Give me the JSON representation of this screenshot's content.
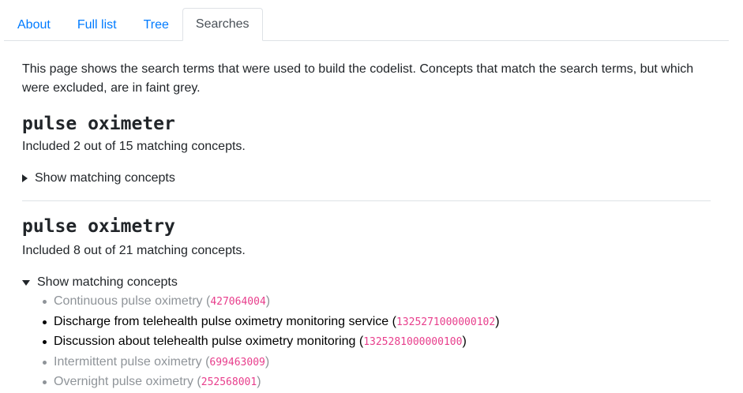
{
  "tabs": [
    {
      "label": "About",
      "active": false
    },
    {
      "label": "Full list",
      "active": false
    },
    {
      "label": "Tree",
      "active": false
    },
    {
      "label": "Searches",
      "active": true
    }
  ],
  "intro": "This page shows the search terms that were used to build the codelist. Concepts that match the search terms, but which were excluded, are in faint grey.",
  "searches": [
    {
      "term": "pulse oximeter",
      "summary": "Included 2 out of 15 matching concepts.",
      "toggle_label": "Show matching concepts",
      "expanded": false
    },
    {
      "term": "pulse oximetry",
      "summary": "Included 8 out of 21 matching concepts.",
      "toggle_label": "Show matching concepts",
      "expanded": true,
      "concepts": [
        {
          "name": "Continuous pulse oximetry",
          "code": "427064004",
          "included": false
        },
        {
          "name": "Discharge from telehealth pulse oximetry monitoring service",
          "code": "1325271000000102",
          "included": true
        },
        {
          "name": "Discussion about telehealth pulse oximetry monitoring",
          "code": "1325281000000100",
          "included": true
        },
        {
          "name": "Intermittent pulse oximetry",
          "code": "699463009",
          "included": false
        },
        {
          "name": "Overnight pulse oximetry",
          "code": "252568001",
          "included": false
        }
      ]
    }
  ],
  "colors": {
    "link": "#007bff",
    "excluded": "#8f9499",
    "code": "#e83e8c"
  }
}
